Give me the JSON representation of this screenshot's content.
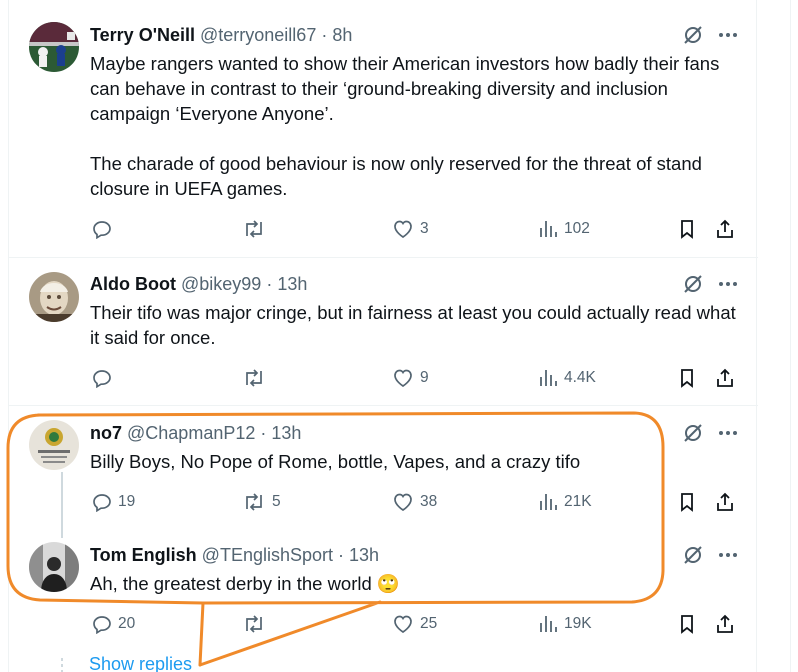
{
  "tweets": [
    {
      "name": "Terry O'Neill",
      "handle": "@terryoneill67",
      "dot": "·",
      "time": "8h",
      "text": "Maybe rangers wanted to show their American investors how badly their fans can behave in contrast to their ‘ground-breaking diversity and inclusion campaign ‘Everyone Anyone’.\n\nThe charade of good behaviour is now only reserved for the threat of stand closure in UEFA games.",
      "replies": "",
      "retweets": "",
      "likes": "3",
      "views": "102"
    },
    {
      "name": "Aldo Boot",
      "handle": "@bikey99",
      "dot": "·",
      "time": "13h",
      "text": "Their tifo was major cringe, but in fairness at least you could actually read what it said for once.",
      "replies": "",
      "retweets": "",
      "likes": "9",
      "views": "4.4K"
    },
    {
      "name": "no7",
      "handle": "@ChapmanP12",
      "dot": "·",
      "time": "13h",
      "text": "Billy Boys, No Pope of Rome, bottle, Vapes, and a crazy tifo",
      "replies": "19",
      "retweets": "5",
      "likes": "38",
      "views": "21K"
    },
    {
      "name": "Tom English",
      "handle": "@TEnglishSport",
      "dot": "·",
      "time": "13h",
      "text": "Ah, the greatest derby in the world",
      "emoji": "🙄",
      "replies": "20",
      "retweets": "",
      "likes": "25",
      "views": "19K"
    }
  ],
  "show_replies": "Show replies",
  "colors": {
    "annotation": "#f08a2a",
    "link": "#1d9bf0",
    "muted": "#536471",
    "text": "#0f1419"
  }
}
